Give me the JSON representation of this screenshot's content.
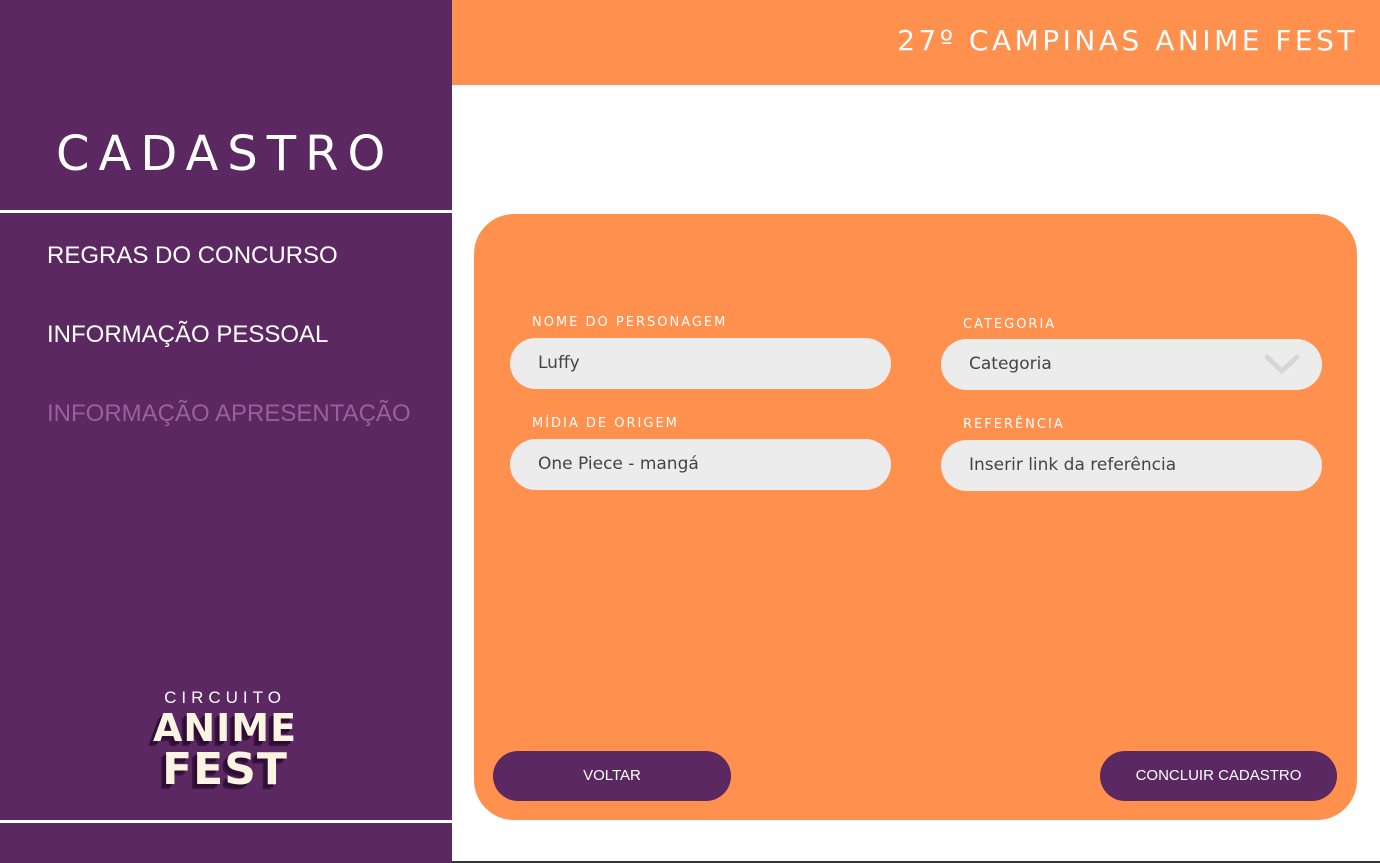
{
  "sidebar": {
    "title": "CADASTRO",
    "nav": [
      {
        "label": "REGRAS DO CONCURSO"
      },
      {
        "label": "INFORMAÇÃO PESSOAL"
      },
      {
        "label": "INFORMAÇÃO APRESENTAÇÃO"
      }
    ],
    "logo": {
      "line1": "CIRCUITO",
      "line2": "ANIME",
      "line3": "FEST"
    }
  },
  "header": {
    "title": "27º CAMPINAS ANIME FEST"
  },
  "form": {
    "character_name": {
      "label": "NOME DO PERSONAGEM",
      "value": "Luffy"
    },
    "category": {
      "label": "CATEGORIA",
      "value": "Categoria",
      "icon": "chevron-down-icon"
    },
    "origin_media": {
      "label": "MÍDIA DE ORIGEM",
      "value": "One Piece - mangá"
    },
    "reference": {
      "label": "REFERÊNCIA",
      "placeholder": "Inserir link da referência"
    }
  },
  "buttons": {
    "back": "VOLTAR",
    "submit": "CONCLUIR CADASTRO"
  },
  "colors": {
    "purple": "#5b2862",
    "orange": "#ff904d",
    "field_bg": "#ececec",
    "nav_active": "#9a5f9c"
  }
}
